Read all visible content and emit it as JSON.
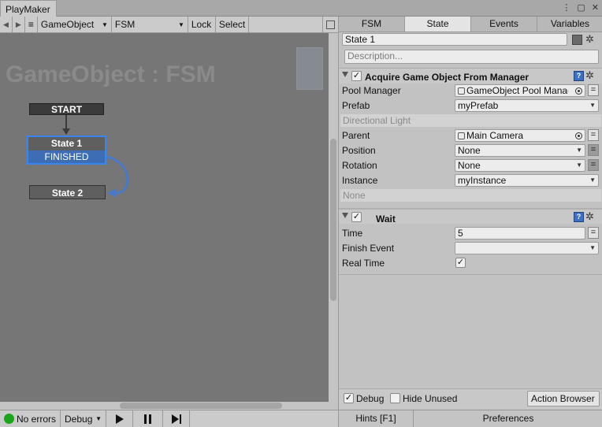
{
  "window": {
    "title": "PlayMaker"
  },
  "toolbar": {
    "gameobject_dropdown": "GameObject",
    "fsm_dropdown": "FSM",
    "lock_label": "Lock",
    "select_label": "Select"
  },
  "canvas": {
    "title": "GameObject : FSM",
    "start_label": "START",
    "state1_label": "State 1",
    "state1_event": "FINISHED",
    "state2_label": "State 2"
  },
  "status": {
    "errors_label": "No errors",
    "debug_dropdown": "Debug"
  },
  "inspector": {
    "tabs": [
      {
        "label": "FSM"
      },
      {
        "label": "State"
      },
      {
        "label": "Events"
      },
      {
        "label": "Variables"
      }
    ],
    "state_name": "State 1",
    "description_placeholder": "Description...",
    "action1": {
      "title": "Acquire Game Object From Manager",
      "fields": {
        "pool_manager_label": "Pool Manager",
        "pool_manager_value": "GameObject Pool Manag",
        "prefab_label": "Prefab",
        "prefab_value": "myPrefab",
        "section_label": "Directional Light",
        "parent_label": "Parent",
        "parent_value": "Main Camera",
        "position_label": "Position",
        "position_value": "None",
        "rotation_label": "Rotation",
        "rotation_value": "None",
        "instance_label": "Instance",
        "instance_value": "myInstance",
        "none_label": "None"
      }
    },
    "action2": {
      "title": "Wait",
      "fields": {
        "time_label": "Time",
        "time_value": "5",
        "finish_event_label": "Finish Event",
        "finish_event_value": "",
        "real_time_label": "Real Time"
      }
    },
    "bottom": {
      "debug_label": "Debug",
      "hide_unused_label": "Hide Unused",
      "action_browser_label": "Action Browser"
    },
    "footer": {
      "hints_label": "Hints [F1]",
      "preferences_label": "Preferences"
    }
  },
  "colors": {
    "canvas_bg": "#767676",
    "selection": "#3a86f0",
    "status_ok": "#1aa51a"
  }
}
